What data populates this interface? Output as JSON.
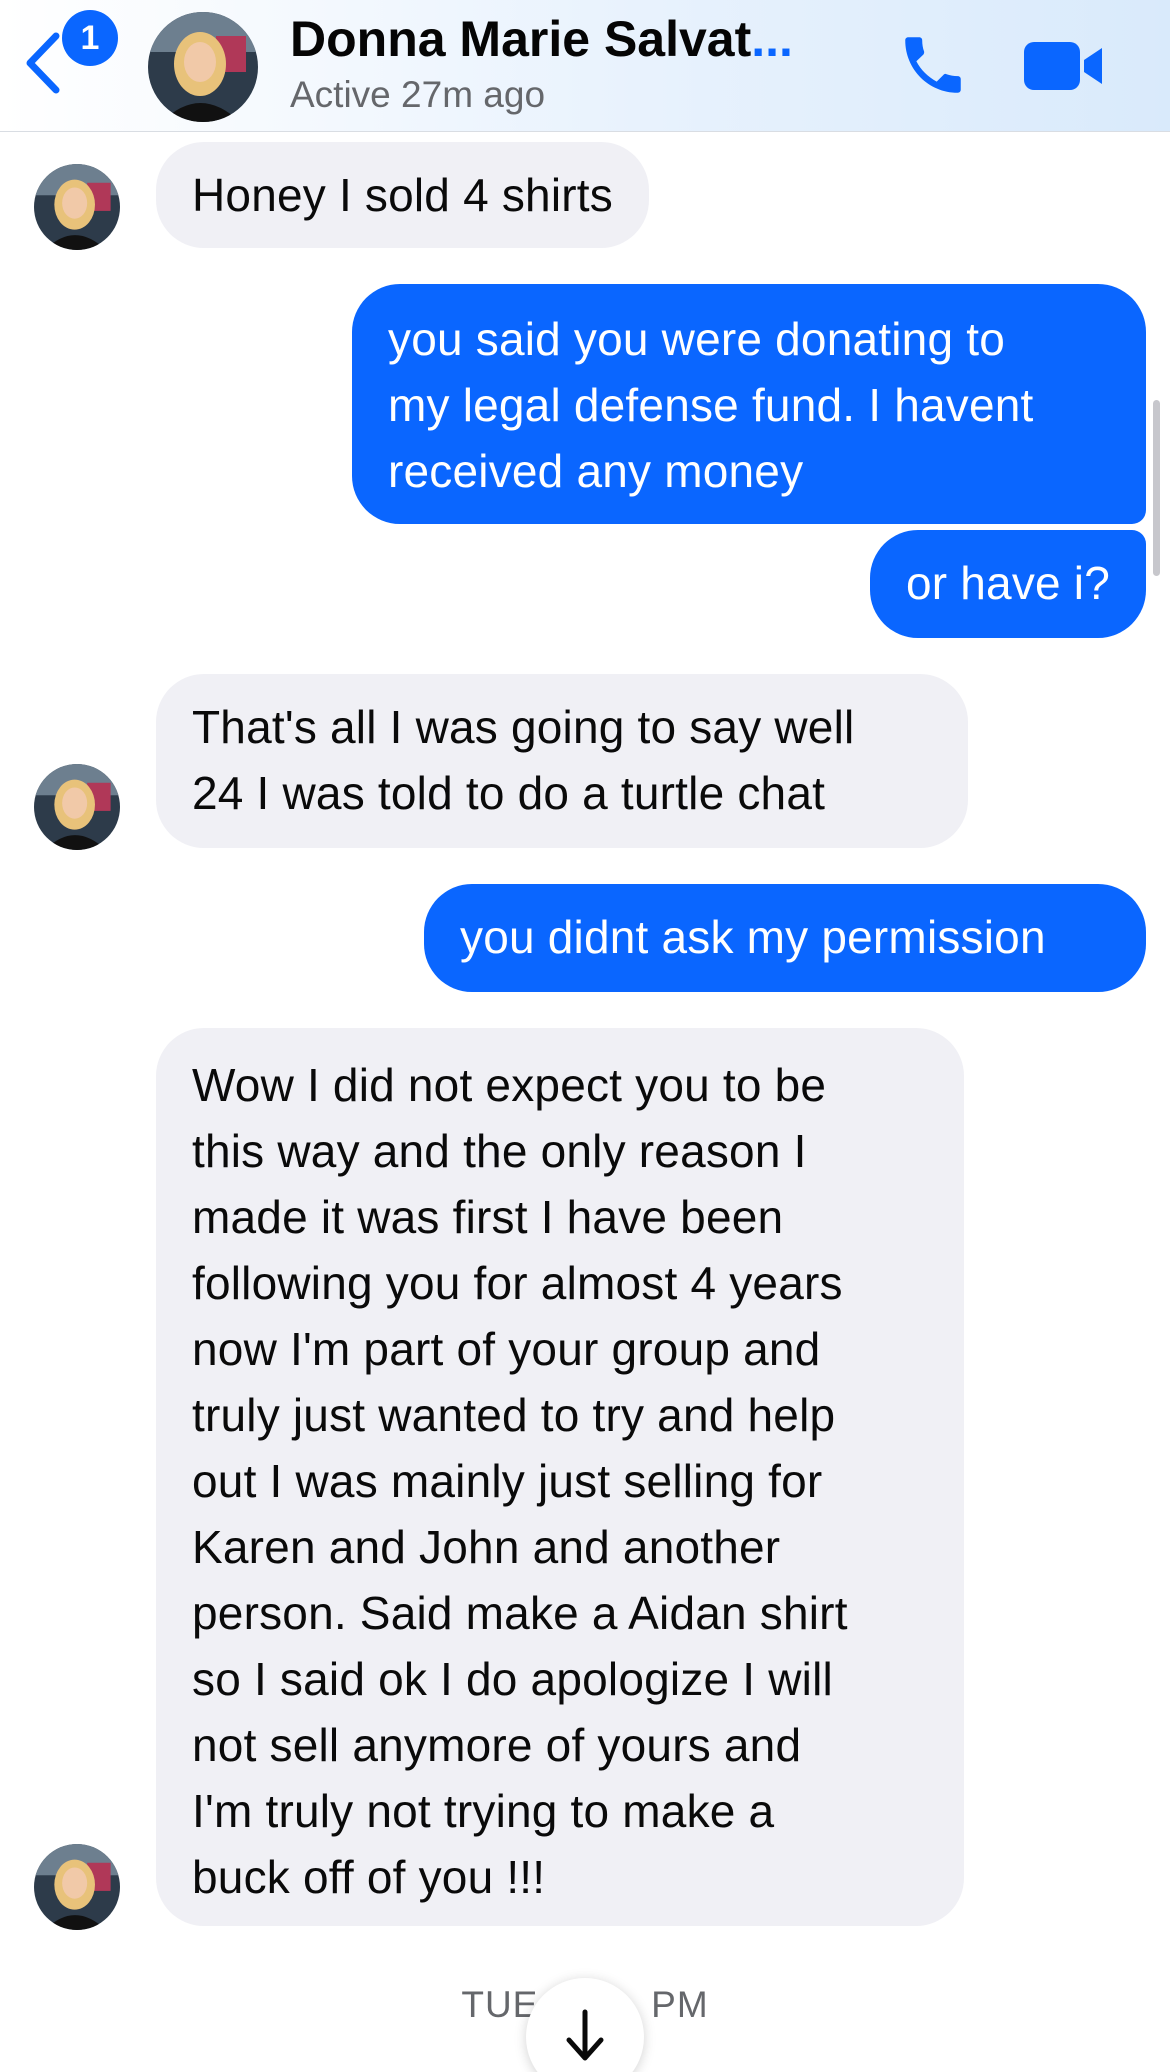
{
  "header": {
    "unread_count": "1",
    "contact_name": "Donna Marie Salvat",
    "name_ellipsis": "...",
    "status": "Active 27m ago"
  },
  "messages": [
    {
      "from": "contact",
      "lines": [
        "Honey I sold 4 shirts"
      ]
    },
    {
      "from": "me",
      "lines": [
        "you said you were donating to",
        "my legal defense fund. I havent",
        "received any money"
      ]
    },
    {
      "from": "me",
      "lines": [
        "or have i?"
      ]
    },
    {
      "from": "contact",
      "lines": [
        "That's all I was going to say well",
        "24 I was told to do a turtle chat"
      ]
    },
    {
      "from": "me",
      "lines": [
        "you didnt ask my permission"
      ]
    },
    {
      "from": "contact",
      "lines": [
        "Wow I did not expect you to be",
        "this way and the only reason I",
        "made it was first I have been",
        "following you for almost 4 years",
        "now I'm part of your group and",
        "truly just wanted to try and help",
        "out I was mainly just selling for",
        "Karen and John and another",
        "person. Said make a Aidan shirt",
        "so I said ok I do apologize I will",
        "not sell anymore of yours and",
        "I'm truly not trying to make a",
        "buck off of you !!!"
      ]
    }
  ],
  "timestamp": "TUE          PM",
  "icons": {
    "back": "chevron-left-icon",
    "call": "phone-icon",
    "video": "video-camera-icon",
    "scroll_down": "arrow-down-icon"
  },
  "colors": {
    "accent": "#0a66ff",
    "incoming_bubble": "#f0f0f5",
    "secondary_text": "#65676b"
  }
}
